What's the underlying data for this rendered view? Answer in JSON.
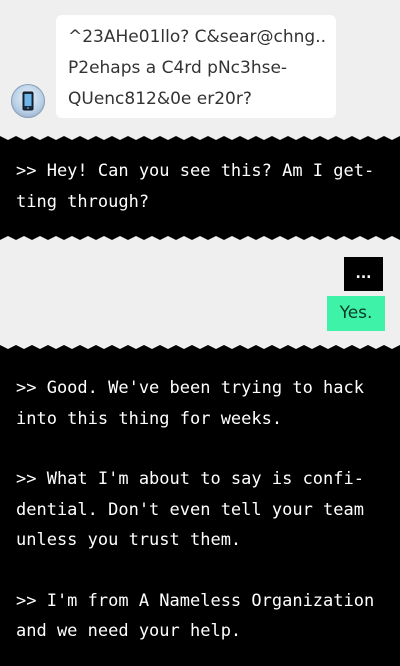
{
  "incoming": {
    "lines": [
      "^23AHe01llo? C&sear@chng...",
      "P2ehaps a C4rd pNc3hse-",
      "QUenc812&0e er20r?"
    ],
    "avatar_icon": "phone-icon"
  },
  "panel1": {
    "lines": [
      ">> Hey! Can you see this? Am I get-",
      "ting through?"
    ]
  },
  "responses": {
    "dots": "...",
    "yes": "Yes."
  },
  "panel2": {
    "paragraphs": [
      [
        ">> Good. We've been trying to hack",
        "into this thing for weeks."
      ],
      [
        ">> What I'm about to say is confi-",
        "dential. Don't even tell your team",
        "unless you trust them."
      ],
      [
        ">> I'm from A Nameless Organization",
        "and we need your help."
      ]
    ]
  },
  "colors": {
    "background": "#efefef",
    "panel": "#000000",
    "accent_green": "#3ef2a8"
  }
}
